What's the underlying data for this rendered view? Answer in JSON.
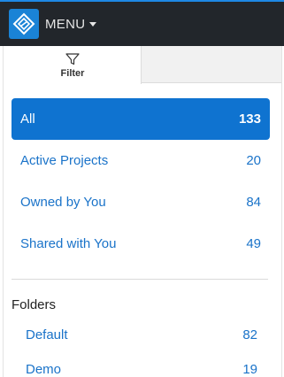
{
  "header": {
    "menu_label": "MENU",
    "logo_icon": "diamond-logo-icon",
    "accent_color": "#1a83d6"
  },
  "tabs": [
    {
      "label": "Filter",
      "icon": "filter-funnel-icon"
    }
  ],
  "filters": [
    {
      "label": "All",
      "count": "133",
      "active": true
    },
    {
      "label": "Active Projects",
      "count": "20"
    },
    {
      "label": "Owned by You",
      "count": "84"
    },
    {
      "label": "Shared with You",
      "count": "49"
    }
  ],
  "folders": {
    "title": "Folders",
    "items": [
      {
        "label": "Default",
        "count": "82"
      },
      {
        "label": "Demo",
        "count": "19"
      }
    ]
  }
}
